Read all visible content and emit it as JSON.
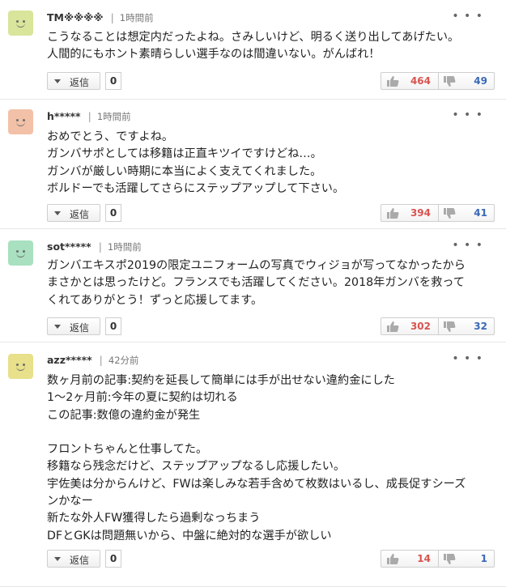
{
  "colors": {
    "like": "#d9534f",
    "dislike": "#3b69b7"
  },
  "comments": [
    {
      "avatar": {
        "icon": "smiley-avatar-icon",
        "bg": "#d8e59a"
      },
      "username": "TM※※※※",
      "time": "1時間前",
      "lines": [
        "こうなることは想定内だったよね。さみしいけど、明るく送り出してあげたい。",
        "人間的にもホント素晴らしい選手なのは間違いない。がんばれ！"
      ],
      "reply_label": "返信",
      "reply_count": "0",
      "likes": "464",
      "dislikes": "49"
    },
    {
      "avatar": {
        "icon": "smiley-avatar-icon",
        "bg": "#f2c1a8"
      },
      "username": "h*****",
      "time": "1時間前",
      "lines": [
        "おめでとう、ですよね。",
        "ガンバサポとしては移籍は正直キツイですけどね…。",
        "ガンバが厳しい時期に本当によく支えてくれました。",
        "ボルドーでも活躍してさらにステップアップして下さい。"
      ],
      "reply_label": "返信",
      "reply_count": "0",
      "likes": "394",
      "dislikes": "41"
    },
    {
      "avatar": {
        "icon": "smiley-avatar-icon",
        "bg": "#a8e0c0"
      },
      "username": "sot*****",
      "time": "1時間前",
      "lines": [
        "ガンバエキスポ2019の限定ユニフォームの写真でウィジョが写ってなかったから",
        "まさかとは思ったけど。フランスでも活躍してください。2018年ガンバを救って",
        "くれてありがとう！ずっと応援してます。"
      ],
      "reply_label": "返信",
      "reply_count": "0",
      "likes": "302",
      "dislikes": "32"
    },
    {
      "avatar": {
        "icon": "smiley-avatar-icon",
        "bg": "#e8e08a"
      },
      "username": "azz*****",
      "time": "42分前",
      "lines": [
        "数ヶ月前の記事:契約を延長して簡単には手が出せない違約金にした",
        "1～2ヶ月前:今年の夏に契約は切れる",
        "この記事:数億の違約金が発生",
        "",
        "フロントちゃんと仕事してた。",
        "移籍なら残念だけど、ステップアップなるし応援したい。",
        "宇佐美は分からんけど、FWは楽しみな若手含めて枚数はいるし、成長促すシーズ",
        "ンかなー",
        "新たな外人FW獲得したら過剰なっちまう",
        "DFとGKは問題無いから、中盤に絶対的な選手が欲しい"
      ],
      "reply_label": "返信",
      "reply_count": "0",
      "likes": "14",
      "dislikes": "1"
    }
  ]
}
